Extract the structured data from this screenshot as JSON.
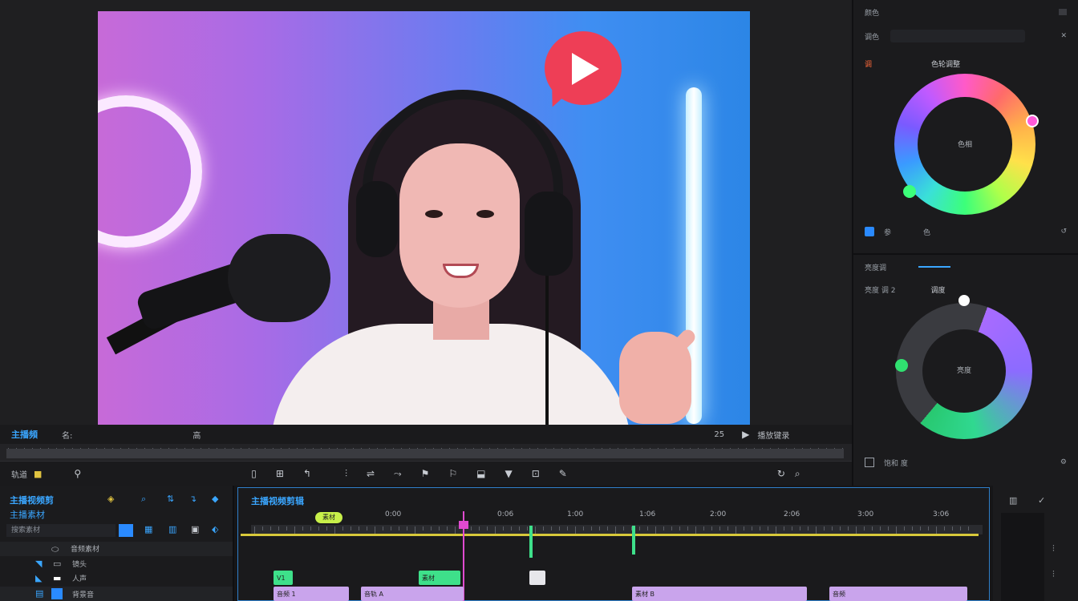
{
  "preview": {
    "overlay_icon": "play-bubble-icon"
  },
  "preview_info": {
    "title": "主播頻",
    "left_code": "名:",
    "center_code": "高",
    "right_code": "25",
    "play_label": "播放键录"
  },
  "transport": {
    "left_label": "轨道",
    "icons": [
      "snap-icon",
      "marker-icon",
      "split-icon",
      "trim-icon",
      "slip-icon",
      "ripple-icon",
      "ramp-icon",
      "mark-in-icon",
      "mark-out-icon",
      "insert-icon",
      "overwrite-icon",
      "export-frame-icon"
    ]
  },
  "color_panel": {
    "title": "颜色",
    "row2_label": "调色",
    "section_badge": "调",
    "section_title": "色轮调整",
    "wheel1_center": "色相",
    "footer_left": "参",
    "footer_mid": "色",
    "wheel2_title": "亮度调",
    "wheel2_sub": "亮度 调 2",
    "wheel2_top": "调度",
    "wheel2_center": "亮度",
    "footer2": "饱和 度"
  },
  "project_panel": {
    "title": "主播视频剪",
    "subtitle": "主播素材",
    "search": "搜索素材",
    "rows": [
      "音频素材",
      "镜头",
      "人声",
      "背景音"
    ]
  },
  "timeline": {
    "title": "主播视频剪辑",
    "tag": "素材",
    "markers": [
      "0:00",
      "0:06",
      "1:00",
      "1:06",
      "2:00",
      "2:06",
      "3:00",
      "3:06"
    ],
    "clips": [
      "V1",
      "素材",
      "音频 1",
      "音轨 A",
      "素材 B",
      "音频"
    ]
  },
  "colors": {
    "accent": "#3aa6ff",
    "playhead": "#e04ad0",
    "timeline_line": "#d8c93a",
    "clip_purple": "#c9a4ec",
    "clip_green": "#3ee08a"
  }
}
